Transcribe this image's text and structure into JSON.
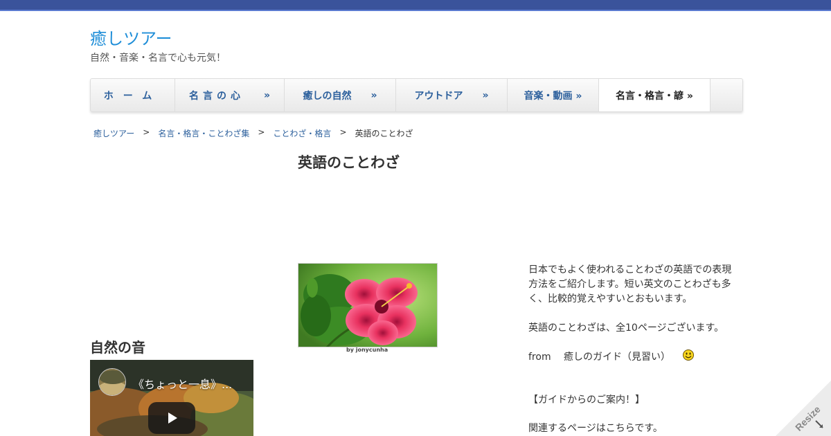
{
  "site": {
    "title": "癒しツアー",
    "tagline": "自然・音楽・名言で心も元気！"
  },
  "nav": {
    "items": [
      {
        "label": "ホーム",
        "arrow": ""
      },
      {
        "label": "名言の心",
        "arrow": "»"
      },
      {
        "label": "癒しの自然",
        "arrow": "»"
      },
      {
        "label": "アウトドア",
        "arrow": "»"
      },
      {
        "label": "音楽・動画 »",
        "arrow": ""
      },
      {
        "label": "名言・格言・諺 »",
        "arrow": ""
      }
    ],
    "active_index": 5
  },
  "breadcrumb": {
    "items": [
      "癒しツアー",
      "名言・格言・ことわざ集",
      "ことわざ・格言",
      "英語のことわざ"
    ],
    "separator": ">"
  },
  "page": {
    "title": "英語のことわざ",
    "image_caption": "by jonycunha",
    "intro": "日本でもよく使われることわざの英語での表現方法をご紹介します。短い英文のことわざも多く、比較的覚えやすいとおもいます。",
    "page_count_text": "英語のことわざは、全10ページございます。",
    "from_text": "from　 癒しのガイド（見習い）",
    "guide_heading": "【ガイドからのご案内！】",
    "related_text": "関連するページはこちらです。"
  },
  "sidebar": {
    "heading": "自然の音",
    "video_title": "《ちょっと一息》..."
  },
  "resize_label": "Resize",
  "colors": {
    "top_bar": "#3a539b",
    "link": "#2b5f9c",
    "site_title": "#1f8ed8"
  },
  "icons": [
    "smiley-icon",
    "play-icon",
    "resize-arrow-icon"
  ]
}
